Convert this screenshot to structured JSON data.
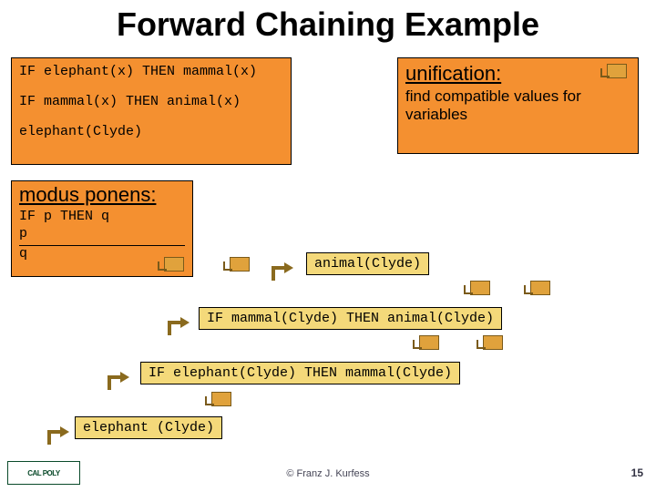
{
  "title": "Forward Chaining Example",
  "rules": {
    "r1": "IF elephant(x) THEN mammal(x)",
    "r2": "IF mammal(x) THEN animal(x)",
    "fact": "elephant(Clyde)"
  },
  "unification": {
    "heading": "unification:",
    "desc": "find compatible values for variables"
  },
  "modus": {
    "heading": "modus ponens:",
    "l1": "IF p THEN q",
    "l2": "p",
    "l3": "q"
  },
  "steps": {
    "animal": "animal(Clyde)",
    "mammal_rule": "IF mammal(Clyde) THEN animal(Clyde)",
    "elephant_rule": "IF elephant(Clyde) THEN mammal(Clyde)",
    "elephant_fact": "elephant (Clyde)"
  },
  "footer": {
    "logo": "CAL POLY",
    "copyright": "© Franz J. Kurfess",
    "page": "15"
  }
}
